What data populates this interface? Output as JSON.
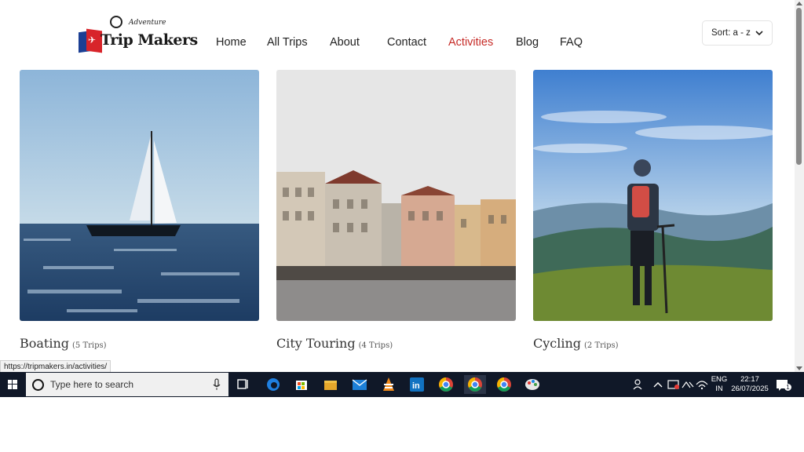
{
  "header": {
    "logo": {
      "name": "Trip Makers",
      "tagline": "Adventure"
    },
    "nav": [
      {
        "label": "Home",
        "active": false
      },
      {
        "label": "All Trips",
        "active": false
      },
      {
        "label": "About",
        "active": false
      },
      {
        "label": "Contact",
        "active": false
      },
      {
        "label": "Activities",
        "active": true
      },
      {
        "label": "Blog",
        "active": false
      },
      {
        "label": "FAQ",
        "active": false
      }
    ],
    "sort": {
      "label": "Sort: a - z"
    }
  },
  "activities": [
    {
      "title": "Boating",
      "count": "(5 Trips)",
      "image": "sailboat-photo"
    },
    {
      "title": "City Touring",
      "count": "(4 Trips)",
      "image": "city-square-photo"
    },
    {
      "title": "Cycling",
      "count": "(2 Trips)",
      "image": "mountain-cyclist-photo"
    }
  ],
  "status_url": "https://tripmakers.in/activities/",
  "taskbar": {
    "search_placeholder": "Type here to search",
    "apps": [
      "task-view",
      "edge",
      "store",
      "file-explorer",
      "mail",
      "vlc",
      "linkedin",
      "chrome-profile-1",
      "chrome-profile-2",
      "chrome-profile-3",
      "paint"
    ],
    "tray": {
      "language_top": "ENG",
      "language_bottom": "IN",
      "time": "22:17",
      "date": "26/07/2025",
      "notification_count": "1"
    }
  },
  "colors": {
    "accent_red": "#c62b27",
    "taskbar": "#101828",
    "text": "#222222"
  }
}
